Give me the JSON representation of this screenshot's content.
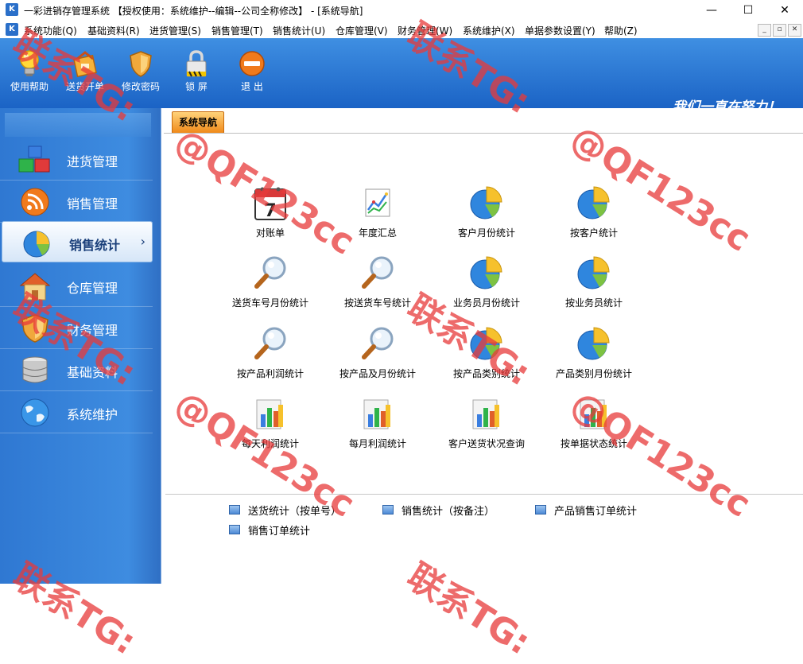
{
  "window": {
    "app_icon_text": "K",
    "title": "一彩进销存管理系统 【授权使用：系统维护--编辑--公司全称修改】 - [系统导航]",
    "controls": [
      "—",
      "☐",
      "✕"
    ]
  },
  "menubar": {
    "items": [
      "系统功能(Q)",
      "基础资料(R)",
      "进货管理(S)",
      "销售管理(T)",
      "销售统计(U)",
      "仓库管理(V)",
      "财务管理(W)",
      "系统维护(X)",
      "单据参数设置(Y)",
      "帮助(Z)"
    ],
    "mdi_controls": [
      "_",
      "▫",
      "✕"
    ]
  },
  "toolbar": {
    "buttons": [
      {
        "label": "使用帮助",
        "icon": "lightbulb-icon"
      },
      {
        "label": "送货开单",
        "icon": "delivery-order-icon"
      },
      {
        "label": "修改密码",
        "icon": "shield-icon"
      },
      {
        "label": "锁  屏",
        "icon": "lock-icon"
      },
      {
        "label": "退  出",
        "icon": "exit-icon"
      }
    ],
    "slogan": "我们一直在努力！"
  },
  "sidebar": {
    "items": [
      {
        "label": "进货管理",
        "icon": "blocks-icon",
        "active": false
      },
      {
        "label": "销售管理",
        "icon": "rss-icon",
        "active": false
      },
      {
        "label": "销售统计",
        "icon": "pie-chart-icon",
        "active": true
      },
      {
        "label": "仓库管理",
        "icon": "house-icon",
        "active": false
      },
      {
        "label": "财务管理",
        "icon": "shield-icon",
        "active": false
      },
      {
        "label": "基础资料",
        "icon": "database-icon",
        "active": false
      },
      {
        "label": "系统维护",
        "icon": "globe-icon",
        "active": false
      }
    ],
    "active_arrow": "›"
  },
  "main": {
    "tab_label": "系统导航",
    "grid": [
      {
        "label": "对账单",
        "icon": "calendar-icon",
        "calendar_day": "7"
      },
      {
        "label": "年度汇总",
        "icon": "line-chart-icon"
      },
      {
        "label": "客户月份统计",
        "icon": "pie-chart-icon"
      },
      {
        "label": "按客户统计",
        "icon": "pie-chart-icon"
      },
      {
        "label": "送货车号月份统计",
        "icon": "magnifier-icon"
      },
      {
        "label": "按送货车号统计",
        "icon": "magnifier-icon"
      },
      {
        "label": "业务员月份统计",
        "icon": "pie-chart-icon"
      },
      {
        "label": "按业务员统计",
        "icon": "pie-chart-icon"
      },
      {
        "label": "按产品利润统计",
        "icon": "magnifier-icon"
      },
      {
        "label": "按产品及月份统计",
        "icon": "magnifier-icon"
      },
      {
        "label": "按产品类别统计",
        "icon": "pie-chart-icon"
      },
      {
        "label": "产品类别月份统计",
        "icon": "pie-chart-icon"
      },
      {
        "label": "每天利润统计",
        "icon": "bar-chart-icon"
      },
      {
        "label": "每月利润统计",
        "icon": "bar-chart-icon"
      },
      {
        "label": "客户送货状况查询",
        "icon": "bar-chart-icon"
      },
      {
        "label": "按单据状态统计",
        "icon": "bar-chart-icon"
      }
    ],
    "links": [
      "送货统计（按单号）",
      "销售统计（按备注）",
      "产品销售订单统计",
      "销售订单统计"
    ]
  },
  "watermark": {
    "line1": "联系TG:",
    "line2": "@QF123cc"
  },
  "colors": {
    "toolbar_top": "#3f8fe2",
    "toolbar_bottom": "#1b63c5",
    "sidebar": "#3e8ce0",
    "tab_orange": "#f08a1a",
    "watermark": "#e83a3a"
  }
}
